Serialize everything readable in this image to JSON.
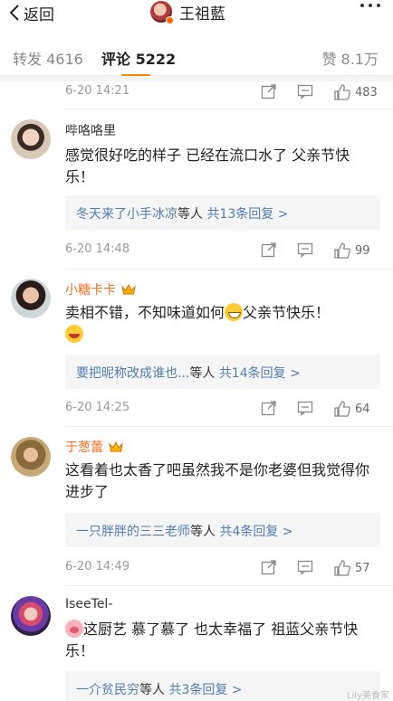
{
  "topbar": {
    "back_label": "返回",
    "poster_name": "王祖藍"
  },
  "tabs": {
    "repost": "转发 4616",
    "comment": "评论 5222",
    "like": "赞 8.1万"
  },
  "comments": [
    {
      "time": "6-20 14:21",
      "likes": "483"
    },
    {
      "name": "哔咯咯里",
      "text": "感觉很好吃的样子  已经在流口水了 父亲节快乐！",
      "reply_who": "冬天来了小手冰凉",
      "reply_mid": "等人 ",
      "reply_count": "共13条回复 >",
      "time": "6-20 14:48",
      "likes": "99"
    },
    {
      "name": "小糖卡卡",
      "text_a": "卖相不错，不知味道如何",
      "text_b": "父亲节快乐！",
      "reply_who": "要把昵称改成谁也...",
      "reply_mid": "等人 ",
      "reply_count": "共14条回复 >",
      "time": "6-20 14:25",
      "likes": "64"
    },
    {
      "name": "于葱蕾",
      "text": "这看着也太香了吧虽然我不是你老婆但我觉得你进步了",
      "reply_who": "一只胖胖的三三老师",
      "reply_mid": "等人 ",
      "reply_count": "共4条回复 >",
      "time": "6-20 14:49",
      "likes": "57"
    },
    {
      "name": "IseeTel-",
      "text": "这厨艺 慕了慕了 也太幸福了 祖蓝父亲节快乐！",
      "reply_who": "一介贫民穷",
      "reply_mid": "等人 ",
      "reply_count": "共3条回复 >"
    }
  ],
  "watermark": "Lily美食家",
  "colors": {
    "accent": "#ff8200",
    "link": "#507daf",
    "vip_name": "#f86e20"
  }
}
